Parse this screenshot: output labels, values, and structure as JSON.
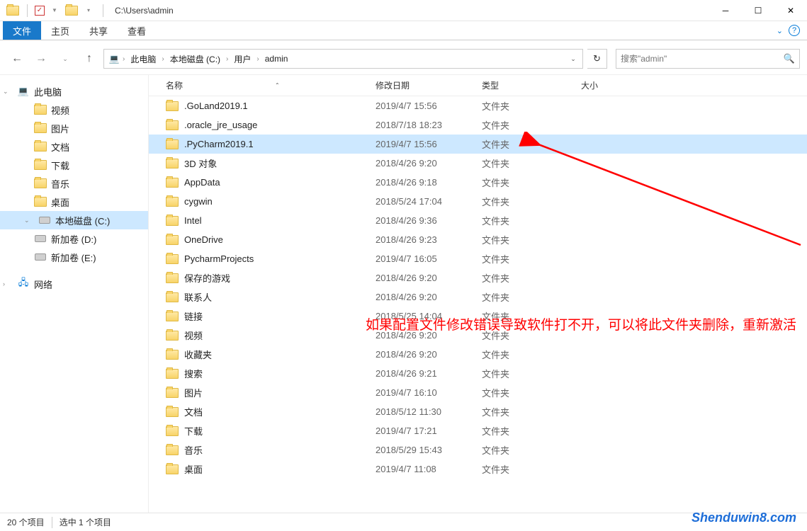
{
  "title": {
    "path": "C:\\Users\\admin"
  },
  "ribbon": {
    "file": "文件",
    "tabs": [
      "主页",
      "共享",
      "查看"
    ]
  },
  "breadcrumb": {
    "items": [
      "此电脑",
      "本地磁盘 (C:)",
      "用户",
      "admin"
    ]
  },
  "search": {
    "placeholder": "搜索\"admin\""
  },
  "columns": {
    "name": "名称",
    "date": "修改日期",
    "type": "类型",
    "size": "大小"
  },
  "sidebar": {
    "thispc": "此电脑",
    "items": [
      {
        "label": "视频",
        "icon": "📹"
      },
      {
        "label": "图片",
        "icon": "🖼"
      },
      {
        "label": "文档",
        "icon": "📄"
      },
      {
        "label": "下载",
        "icon": "⬇"
      },
      {
        "label": "音乐",
        "icon": "🎵"
      },
      {
        "label": "桌面",
        "icon": "🖥"
      }
    ],
    "drives": [
      {
        "label": "本地磁盘 (C:)",
        "selected": true
      },
      {
        "label": "新加卷 (D:)"
      },
      {
        "label": "新加卷 (E:)"
      }
    ],
    "network": "网络"
  },
  "files": [
    {
      "name": ".GoLand2019.1",
      "date": "2019/4/7 15:56",
      "type": "文件夹"
    },
    {
      "name": ".oracle_jre_usage",
      "date": "2018/7/18 18:23",
      "type": "文件夹"
    },
    {
      "name": ".PyCharm2019.1",
      "date": "2019/4/7 15:56",
      "type": "文件夹",
      "selected": true
    },
    {
      "name": "3D 对象",
      "date": "2018/4/26 9:20",
      "type": "文件夹"
    },
    {
      "name": "AppData",
      "date": "2018/4/26 9:18",
      "type": "文件夹"
    },
    {
      "name": "cygwin",
      "date": "2018/5/24 17:04",
      "type": "文件夹"
    },
    {
      "name": "Intel",
      "date": "2018/4/26 9:36",
      "type": "文件夹"
    },
    {
      "name": "OneDrive",
      "date": "2018/4/26 9:23",
      "type": "文件夹"
    },
    {
      "name": "PycharmProjects",
      "date": "2019/4/7 16:05",
      "type": "文件夹"
    },
    {
      "name": "保存的游戏",
      "date": "2018/4/26 9:20",
      "type": "文件夹"
    },
    {
      "name": "联系人",
      "date": "2018/4/26 9:20",
      "type": "文件夹"
    },
    {
      "name": "链接",
      "date": "2018/5/25 14:04",
      "type": "文件夹"
    },
    {
      "name": "视频",
      "date": "2018/4/26 9:20",
      "type": "文件夹"
    },
    {
      "name": "收藏夹",
      "date": "2018/4/26 9:20",
      "type": "文件夹"
    },
    {
      "name": "搜索",
      "date": "2018/4/26 9:21",
      "type": "文件夹"
    },
    {
      "name": "图片",
      "date": "2019/4/7 16:10",
      "type": "文件夹"
    },
    {
      "name": "文档",
      "date": "2018/5/12 11:30",
      "type": "文件夹"
    },
    {
      "name": "下载",
      "date": "2019/4/7 17:21",
      "type": "文件夹"
    },
    {
      "name": "音乐",
      "date": "2018/5/29 15:43",
      "type": "文件夹"
    },
    {
      "name": "桌面",
      "date": "2019/4/7 11:08",
      "type": "文件夹"
    }
  ],
  "status": {
    "count": "20 个项目",
    "selected": "选中 1 个项目"
  },
  "annotation": {
    "text": "如果配置文件修改错误导致软件打不开，可以将此文件夹删除，重新激活"
  },
  "watermark": "Shenduwin8.com"
}
